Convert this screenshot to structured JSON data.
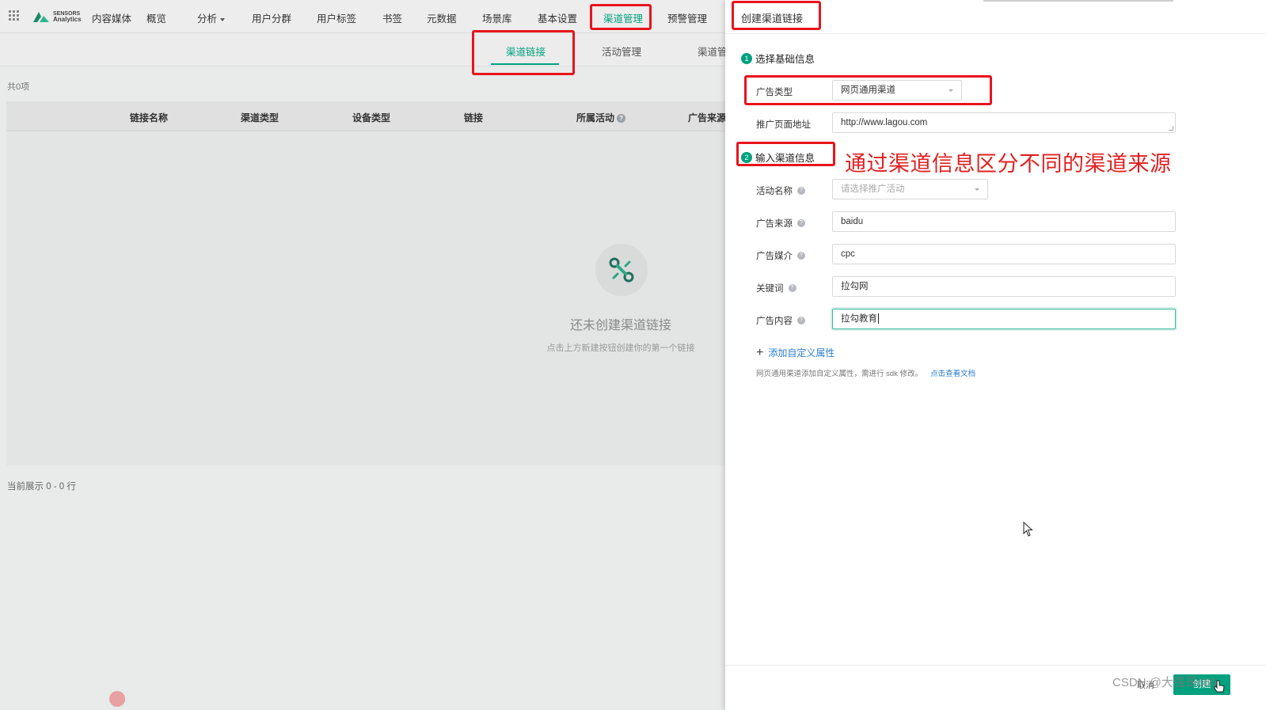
{
  "nav": {
    "brand_line1": "SENSORS",
    "brand_line2": "Analytics",
    "items": [
      {
        "label": "内容媒体"
      },
      {
        "label": "概览"
      },
      {
        "label": "分析"
      },
      {
        "label": "用户分群"
      },
      {
        "label": "用户标签"
      },
      {
        "label": "书签"
      },
      {
        "label": "元数据"
      },
      {
        "label": "场景库"
      },
      {
        "label": "基本设置"
      },
      {
        "label": "渠道管理"
      },
      {
        "label": "预警管理"
      }
    ]
  },
  "subnav": {
    "tabs": [
      {
        "label": "渠道链接"
      },
      {
        "label": "活动管理"
      },
      {
        "label": "渠道管"
      }
    ]
  },
  "list": {
    "count": "共0项",
    "columns": [
      "链接名称",
      "渠道类型",
      "设备类型",
      "链接",
      "所属活动",
      "广告来源"
    ],
    "help_glyph": "?",
    "empty_title": "还未创建渠道链接",
    "empty_sub": "点击上方新建按钮创建你的第一个链接",
    "row_status": "当前展示 0 - 0 行"
  },
  "drawer": {
    "title": "创建渠道链接",
    "section1": {
      "step": "1",
      "title": "选择基础信息"
    },
    "ad_type": {
      "label": "广告类型",
      "value": "网页通用渠道"
    },
    "page_url": {
      "label": "推广页面地址",
      "value": "http://www.lagou.com"
    },
    "section2": {
      "step": "2",
      "title": "输入渠道信息"
    },
    "activity": {
      "label": "活动名称",
      "placeholder": "请选择推广活动"
    },
    "ad_source": {
      "label": "广告来源",
      "value": "baidu"
    },
    "ad_medium": {
      "label": "广告媒介",
      "value": "cpc"
    },
    "keyword": {
      "label": "关键词",
      "value": "拉勾网"
    },
    "ad_content": {
      "label": "广告内容",
      "value": "拉勾教育"
    },
    "add_property": {
      "plus": "+",
      "label": "添加自定义属性"
    },
    "hint": {
      "text": "网页通用渠道添加自定义属性，需进行 sdk 修改。",
      "link": "点击查看文档"
    },
    "footer": {
      "cancel": "取消",
      "create": "创建"
    }
  },
  "annotation": "通过渠道信息区分不同的渠道来源",
  "watermark": "CSDN @大强哥666",
  "colors": {
    "accent": "#00a17e",
    "highlight_box": "#e8141c",
    "annotation": "#e02020",
    "link": "#2b7fd0"
  }
}
